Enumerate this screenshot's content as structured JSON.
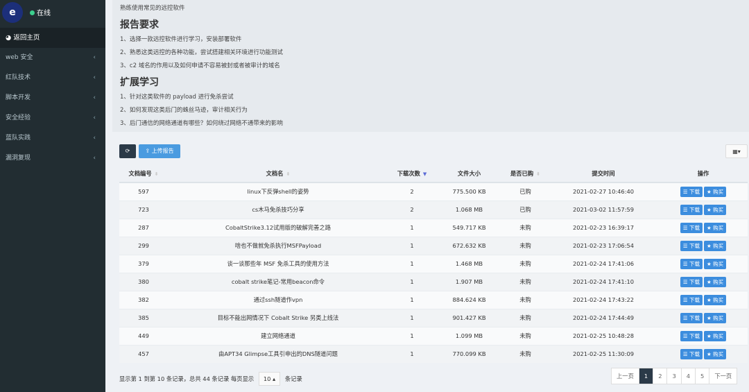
{
  "sidebar": {
    "status": "在线",
    "home": "返回主页",
    "items": [
      {
        "label": "web 安全"
      },
      {
        "label": "红队技术"
      },
      {
        "label": "脚本开发"
      },
      {
        "label": "安全经验"
      },
      {
        "label": "蓝队实践"
      },
      {
        "label": "漏洞复现"
      }
    ]
  },
  "intro": {
    "top": "熟练使用常见的远控软件",
    "h1": "报告要求",
    "req": [
      "1、选择一款远控软件进行学习，安装部署软件",
      "2、熟悉这类远控的各种功能，尝试搭建相关环境进行功能测试",
      "3、c2 域名的作用以及如何申请不容易被封或者被审计的域名"
    ],
    "h2": "扩展学习",
    "ext": [
      "1、针对这类软件的 payload 进行免杀尝试",
      "2、如何发现这类后门的蛛丝马迹，审计相关行为",
      "3、后门通信的网络通道有哪些？如何绕过网络不通带来的影响"
    ]
  },
  "toolbar": {
    "upload": "上传报告"
  },
  "table": {
    "headers": [
      "文档编号",
      "文档名",
      "下载次数",
      "文件大小",
      "是否已购",
      "提交时间",
      "操作"
    ],
    "download": "下载",
    "buy": "购买",
    "rows": [
      [
        "597",
        "linux下反弹shell的姿势",
        "2",
        "775.500 KB",
        "已购",
        "2021-02-27 10:46:40"
      ],
      [
        "723",
        "cs木马免杀技巧分享",
        "2",
        "1.068 MB",
        "已购",
        "2021-03-02 11:57:59"
      ],
      [
        "287",
        "CobaltStrike3.12试用版的破解完善之路",
        "1",
        "549.717 KB",
        "未购",
        "2021-02-23 16:39:17"
      ],
      [
        "299",
        "啥也不做就免杀执行MSFPayload",
        "1",
        "672.632 KB",
        "未购",
        "2021-02-23 17:06:54"
      ],
      [
        "379",
        "谈一谈那些年 MSF 免杀工具的使用方法",
        "1",
        "1.468 MB",
        "未购",
        "2021-02-24 17:41:06"
      ],
      [
        "380",
        "cobalt strike笔记-常用beacon命令",
        "1",
        "1.907 MB",
        "未购",
        "2021-02-24 17:41:10"
      ],
      [
        "382",
        "通过ssh隧道作vpn",
        "1",
        "884.624 KB",
        "未购",
        "2021-02-24 17:43:22"
      ],
      [
        "385",
        "目标不能出网情况下 Cobalt Strike 另类上线法",
        "1",
        "901.427 KB",
        "未购",
        "2021-02-24 17:44:49"
      ],
      [
        "449",
        "建立网络通道",
        "1",
        "1.099 MB",
        "未购",
        "2021-02-25 10:48:28"
      ],
      [
        "457",
        "由APT34 Glimpse工具引申出的DNS隧道问题",
        "1",
        "770.099 KB",
        "未购",
        "2021-02-25 11:30:09"
      ]
    ]
  },
  "footer": {
    "info": "显示第 1 到第 10 条记录，总共 44 条记录 每页显示",
    "page_size": "10",
    "suffix": "条记录"
  },
  "pager": {
    "prev": "上一页",
    "pages": [
      "1",
      "2",
      "3",
      "4",
      "5"
    ],
    "next": "下一页",
    "current": "1"
  }
}
